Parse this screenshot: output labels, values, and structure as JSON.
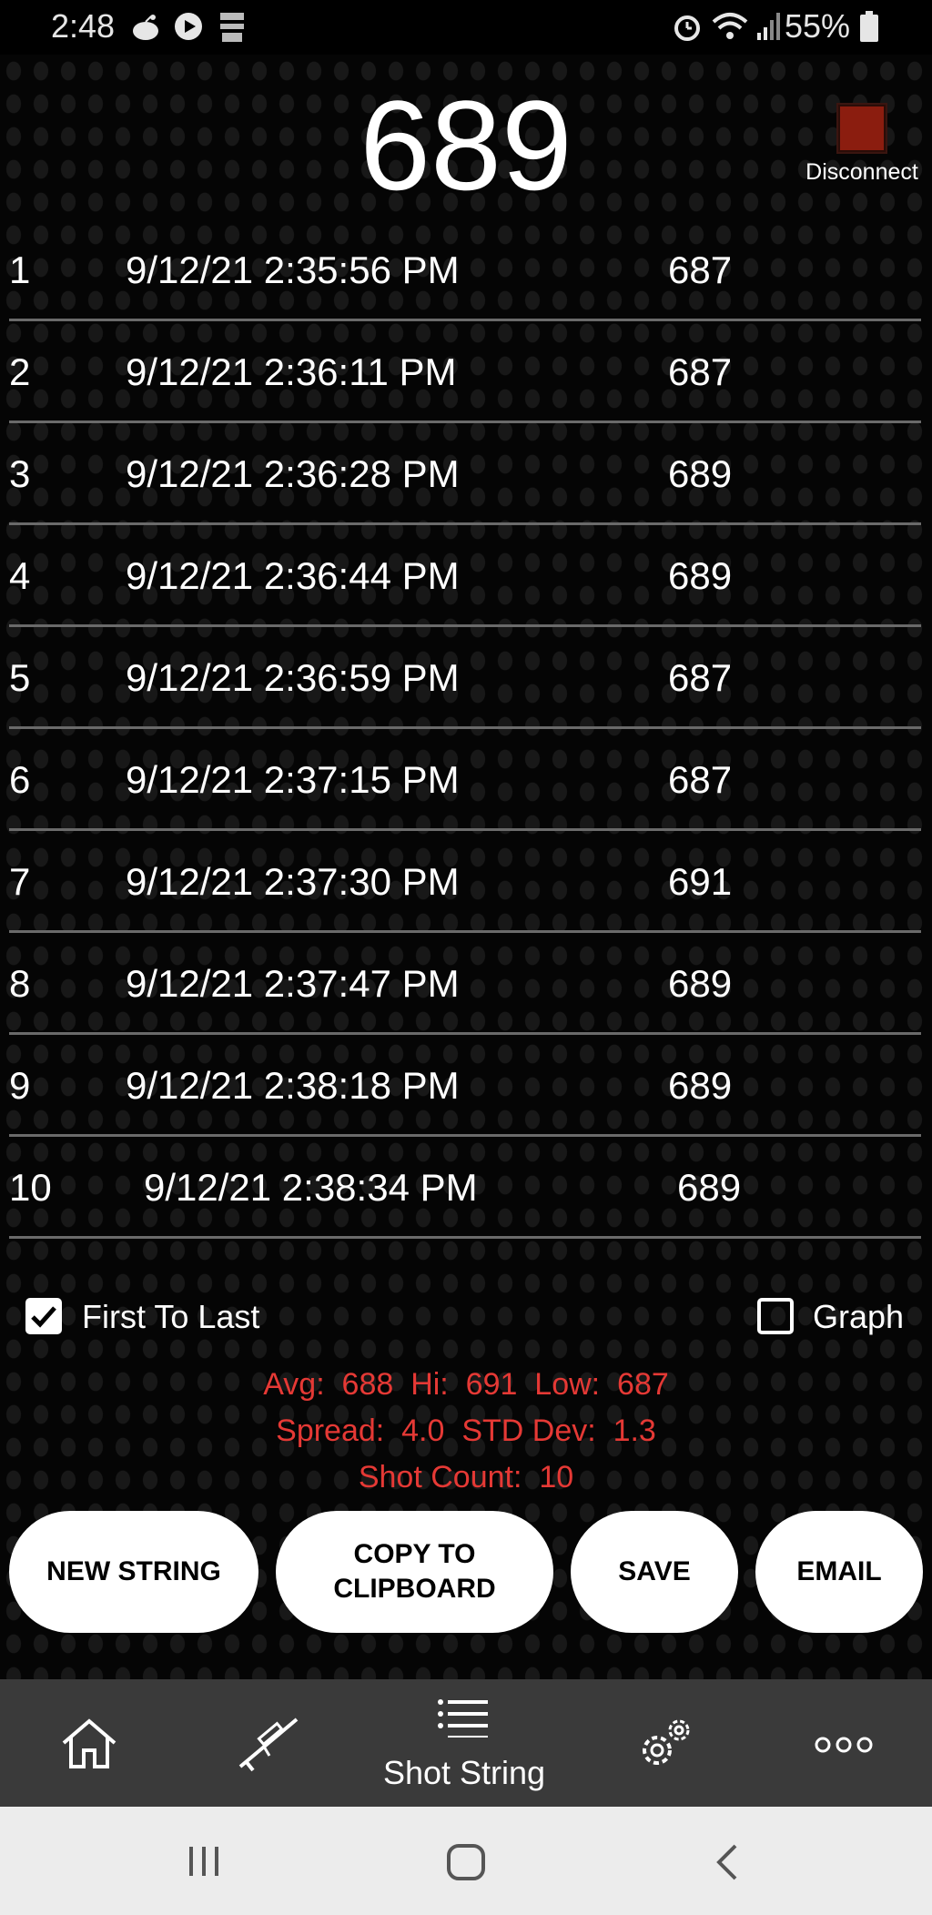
{
  "status_bar": {
    "time": "2:48",
    "battery": "55%"
  },
  "header": {
    "velocity": "689",
    "disconnect_label": "Disconnect",
    "indicator_color": "#8b1d0f"
  },
  "shots": [
    {
      "index": "1",
      "timestamp": "9/12/21 2:35:56 PM",
      "velocity": "687"
    },
    {
      "index": "2",
      "timestamp": "9/12/21 2:36:11 PM",
      "velocity": "687"
    },
    {
      "index": "3",
      "timestamp": "9/12/21 2:36:28 PM",
      "velocity": "689"
    },
    {
      "index": "4",
      "timestamp": "9/12/21 2:36:44 PM",
      "velocity": "689"
    },
    {
      "index": "5",
      "timestamp": "9/12/21 2:36:59 PM",
      "velocity": "687"
    },
    {
      "index": "6",
      "timestamp": "9/12/21 2:37:15 PM",
      "velocity": "687"
    },
    {
      "index": "7",
      "timestamp": "9/12/21 2:37:30 PM",
      "velocity": "691"
    },
    {
      "index": "8",
      "timestamp": "9/12/21 2:37:47 PM",
      "velocity": "689"
    },
    {
      "index": "9",
      "timestamp": "9/12/21 2:38:18 PM",
      "velocity": "689"
    },
    {
      "index": "10",
      "timestamp": "9/12/21 2:38:34 PM",
      "velocity": "689"
    }
  ],
  "options": {
    "first_to_last_label": "First To Last",
    "first_to_last_checked": true,
    "graph_label": "Graph",
    "graph_checked": false
  },
  "stats": {
    "avg_label": "Avg:",
    "avg": "688",
    "hi_label": "Hi:",
    "hi": "691",
    "low_label": "Low:",
    "low": "687",
    "spread_label": "Spread:",
    "spread": "4.0",
    "std_label": "STD Dev:",
    "std": "1.3",
    "count_label": "Shot Count:",
    "count": "10",
    "color": "#e53935"
  },
  "buttons": {
    "new_string": "NEW STRING",
    "copy_line1": "COPY TO",
    "copy_line2": "CLIPBOARD",
    "save": "SAVE",
    "email": "EMAIL"
  },
  "bottom_nav": {
    "active_label": "Shot String",
    "items": [
      "home-icon",
      "rifle-icon",
      "list-icon",
      "settings-gears-icon",
      "more-dots-icon"
    ]
  },
  "system_nav": {
    "items": [
      "recents-icon",
      "home-button-icon",
      "back-icon"
    ]
  }
}
